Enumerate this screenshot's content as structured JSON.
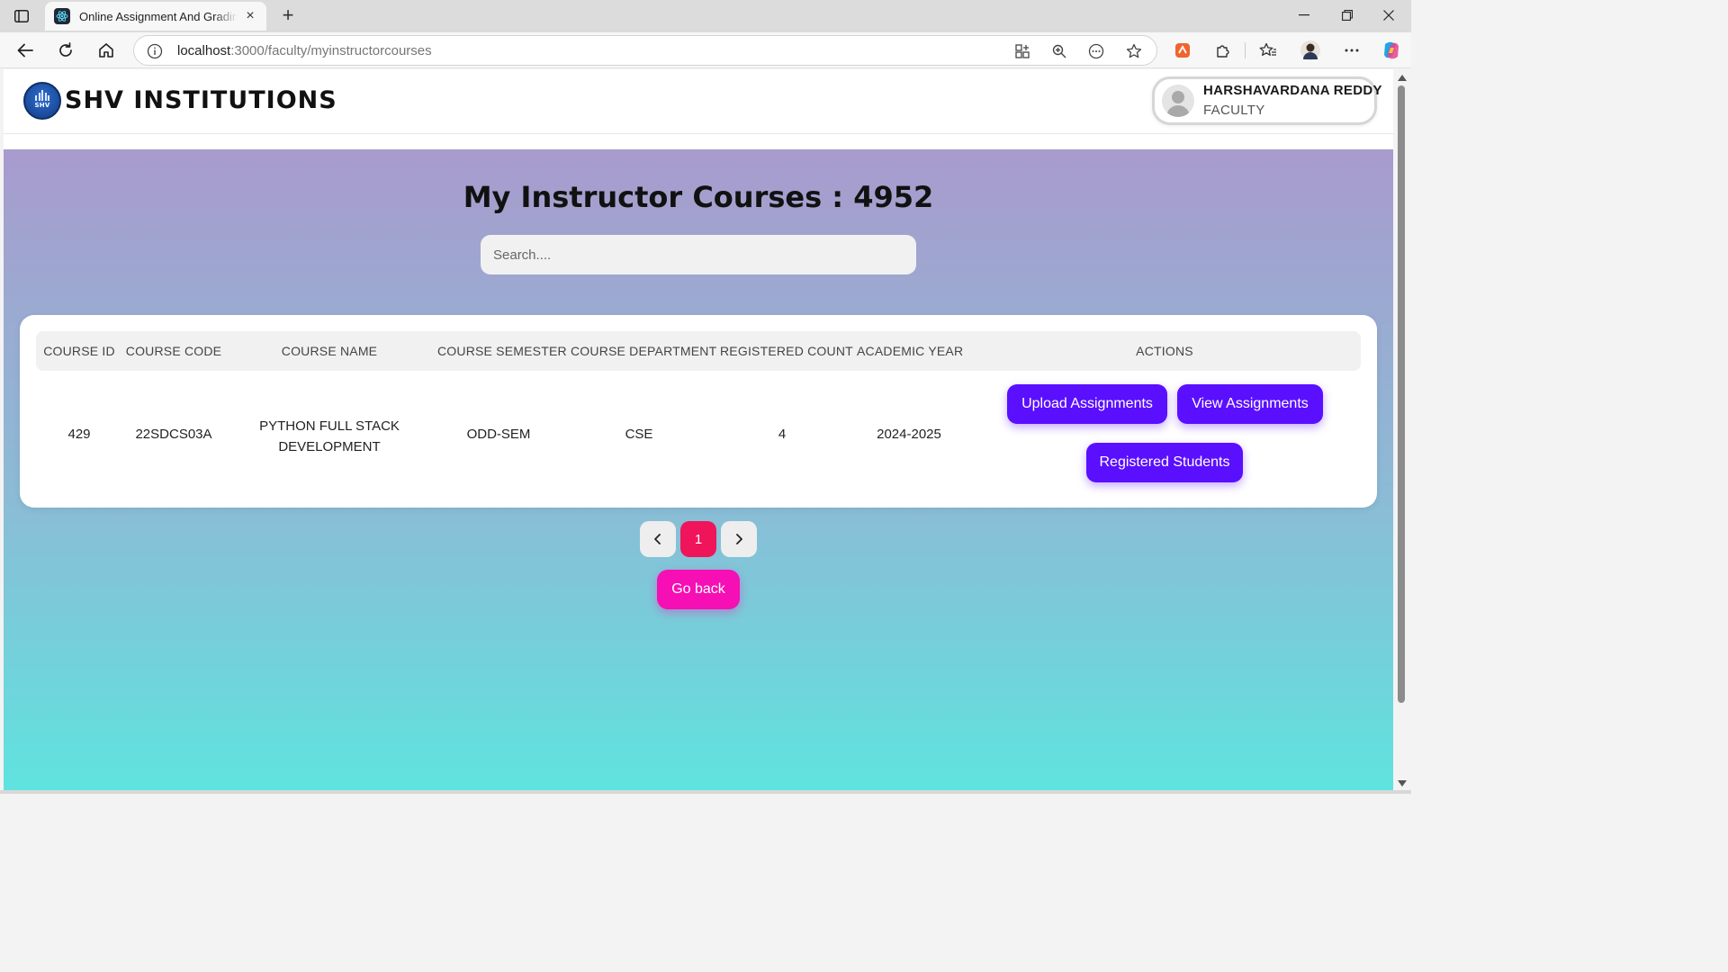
{
  "browser": {
    "tab_title": "Online Assignment And Grading S",
    "url_host": "localhost",
    "url_path": ":3000/faculty/myinstructorcourses"
  },
  "header": {
    "brand": "SHV INSTITUTIONS",
    "logo_abbr": "SHV",
    "user_name": "HARSHAVARDANA REDDY",
    "user_role": "FACULTY"
  },
  "main": {
    "heading": "My Instructor Courses : 4952",
    "search_placeholder": "Search...."
  },
  "table": {
    "columns": [
      "COURSE ID",
      "COURSE CODE",
      "COURSE NAME",
      "COURSE SEMESTER",
      "COURSE DEPARTMENT",
      "REGISTERED COUNT",
      "ACADEMIC YEAR",
      "ACTIONS"
    ],
    "rows": [
      {
        "course_id": "429",
        "course_code": "22SDCS03A",
        "course_name": "PYTHON FULL STACK DEVELOPMENT",
        "semester": "ODD-SEM",
        "department": "CSE",
        "registered_count": "4",
        "academic_year": "2024-2025",
        "actions": [
          "Upload Assignments",
          "View Assignments",
          "Registered Students"
        ]
      }
    ]
  },
  "pagination": {
    "current_page": "1"
  },
  "go_back_label": "Go back",
  "colors": {
    "action_button": "#5a0fff",
    "active_page": "#f0145a",
    "go_back": "#f50fb4",
    "gradient_top": "#a89bcd",
    "gradient_bottom": "#5fe3df"
  }
}
